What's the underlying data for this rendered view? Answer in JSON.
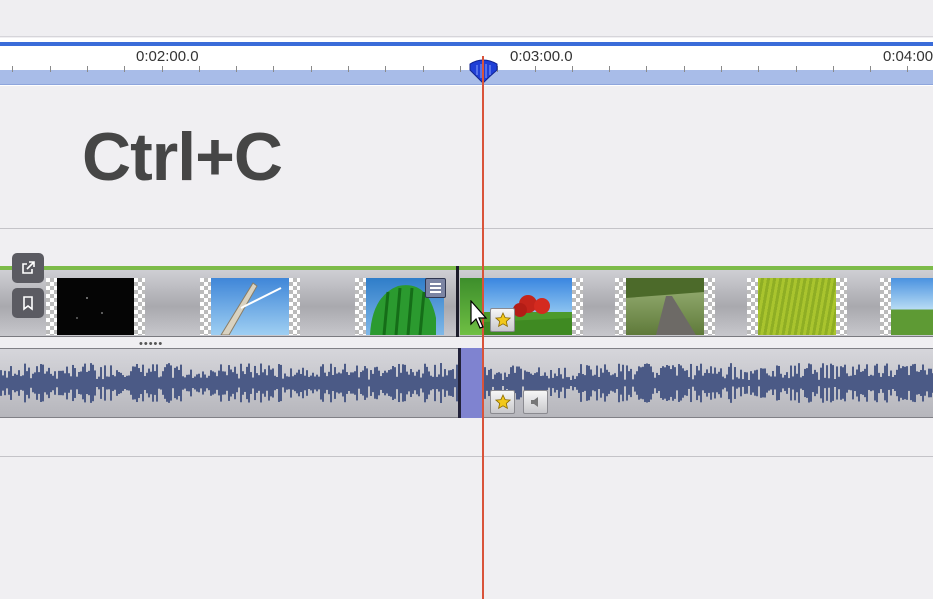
{
  "timeline": {
    "ruler_labels": [
      "0:02:00.0",
      "0:03:00.0",
      "0:04:00"
    ]
  },
  "overlay": {
    "shortcut_text": "Ctrl+C"
  },
  "side_actions": [
    {
      "icon": "external-link-icon"
    },
    {
      "icon": "bookmark-icon"
    }
  ],
  "video_track": {
    "clips": [
      {
        "name": "dark-scene"
      },
      {
        "name": "sky-tower"
      },
      {
        "name": "green-machine"
      },
      {
        "name": "tomatoes"
      },
      {
        "name": "road"
      },
      {
        "name": "grass-field"
      },
      {
        "name": "countryside"
      }
    ],
    "more_indicator": "•••••"
  },
  "audio_track": {
    "fx_icons": [
      "star-icon",
      "speaker-icon"
    ]
  },
  "colors": {
    "playhead": "#d9533a",
    "ruler_accent": "#3a6cd9",
    "video_track_top": "#7dbb4a",
    "audio_selection": "#7f83d0",
    "waveform": "#4b5a86"
  }
}
